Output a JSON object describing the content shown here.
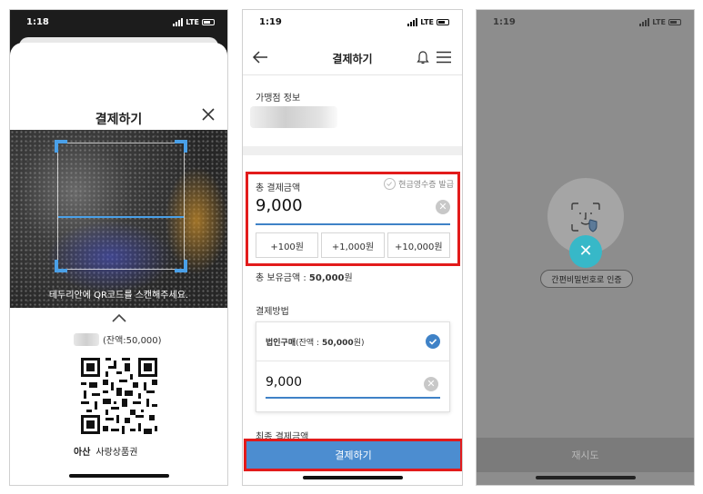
{
  "panel1": {
    "status_time": "1:18",
    "status_network": "LTE",
    "title": "결제하기",
    "scan_hint": "테두리안에 QR코드를 스캔해주세요.",
    "balance_text": "(잔액:50,000)",
    "brand_name": "아산",
    "voucher_name": "사랑상품권"
  },
  "panel2": {
    "status_time": "1:19",
    "status_network": "LTE",
    "title": "결제하기",
    "merchant_label": "가맹점 정보",
    "total_label": "총 결제금액",
    "cash_receipt_label": "현금영수증 발급",
    "total_value": "9,000",
    "quick_buttons": [
      "+100원",
      "+1,000원",
      "+10,000원"
    ],
    "holding_label": "총 보유금액 : ",
    "holding_value": "50,000",
    "holding_unit": "원",
    "method_label": "결제방법",
    "method_name": "법인구매",
    "method_balance": "(잔액 : ",
    "method_balance_value": "50,000",
    "method_balance_unit": "원)",
    "method_amount": "9,000",
    "final_label": "최종 결제금액",
    "pay_button": "결제하기"
  },
  "panel3": {
    "status_time": "1:19",
    "status_network": "LTE",
    "close_symbol": "✕",
    "pin_auth_button": "간편비밀번호로 인증",
    "retry_button": "재시도"
  },
  "colors": {
    "accent_blue": "#4c8dd0",
    "highlight_red": "#e21b1b",
    "teal": "#37b8c8"
  }
}
